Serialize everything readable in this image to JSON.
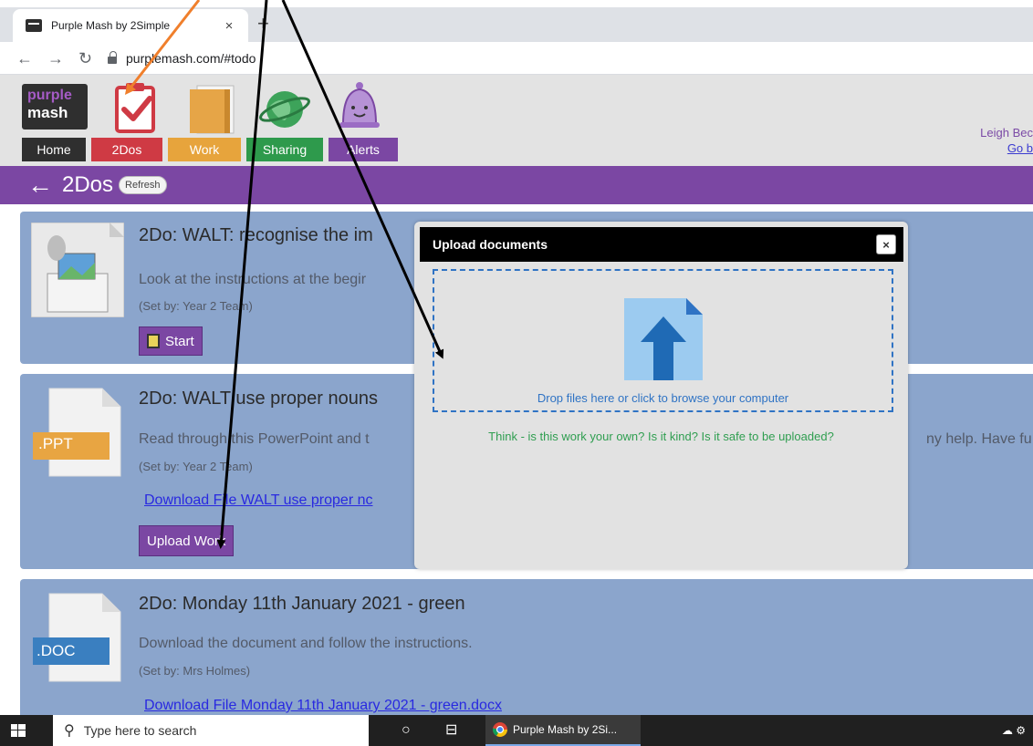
{
  "browser": {
    "tab_title": "Purple Mash by 2Simple",
    "tab_close": "×",
    "new_tab": "+",
    "url": "purplemash.com/#todo"
  },
  "header": {
    "logo_line1": "purple",
    "logo_line2": "mash",
    "nav": [
      {
        "label": "Home",
        "color": "#2f2f2f"
      },
      {
        "label": "2Dos",
        "color": "#cf3a44"
      },
      {
        "label": "Work",
        "color": "#e7a43c"
      },
      {
        "label": "Sharing",
        "color": "#2e9a4c"
      },
      {
        "label": "Alerts",
        "color": "#7b47a3"
      }
    ],
    "user_name": "Leigh Bec",
    "go_back": "Go b"
  },
  "titlebar": {
    "title": "2Dos",
    "refresh": "Refresh"
  },
  "cards": [
    {
      "title": "2Do: WALT: recognise the im",
      "description": "Look at the instructions at the begir",
      "set_by": "(Set by: Year 2 Team)",
      "button": "Start"
    },
    {
      "file_label": ".PPT",
      "title": "2Do: WALT use proper nouns",
      "description": "Read through this PowerPoint and t",
      "description_tail": "ny help. Have fu",
      "set_by": "(Set by: Year 2 Team)",
      "download": "Download File WALT use proper nc",
      "button": "Upload Work"
    },
    {
      "file_label": ".DOC",
      "title": "2Do: Monday 11th January 2021 - green",
      "description": "Download the document and follow the instructions.",
      "set_by": "(Set by: Mrs Holmes)",
      "download": "Download File Monday 11th January 2021 - green.docx"
    }
  ],
  "modal": {
    "title": "Upload documents",
    "close": "×",
    "drop_text": "Drop files here or click to browse your computer",
    "warning": "Think - is this work your own? Is it kind? Is it safe to be uploaded?"
  },
  "taskbar": {
    "search_placeholder": "Type here to search",
    "chrome_label": "Purple Mash by 2Si..."
  },
  "colors": {
    "purple": "#7b47a3",
    "card_bg": "#8ba5cc",
    "link": "#2929e0",
    "dropzone": "#2f73c4",
    "warning": "#2f9e50",
    "annotation_orange": "#f07f2c"
  }
}
